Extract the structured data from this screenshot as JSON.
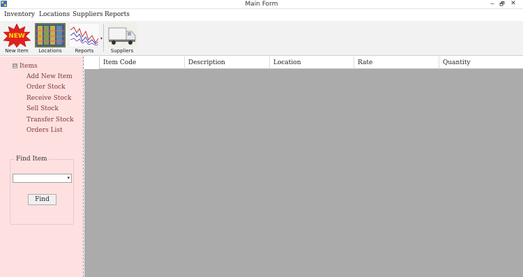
{
  "window": {
    "title": "Main Form",
    "controls": {
      "minimize": "─",
      "restore": "🗗",
      "close": "✕"
    }
  },
  "menu": [
    "Inventory",
    "Locations",
    "Suppliers",
    "Reports"
  ],
  "toolbar": {
    "new_item": {
      "label": "New Item",
      "badge": "NEW"
    },
    "locations": {
      "label": "Locations"
    },
    "reports": {
      "label": "Reports",
      "dropdown": "▾"
    },
    "suppliers": {
      "label": "Suppliers"
    }
  },
  "tree": {
    "toggle": "⊟",
    "root": "Items",
    "children": [
      "Add New Item",
      "Order Stock",
      "Receive Stock",
      "Sell Stock",
      "Transfer Stock",
      "Orders List"
    ]
  },
  "find": {
    "legend": "Find Item",
    "select_value": "",
    "chevron": "▾",
    "button": "Find"
  },
  "grid": {
    "columns": [
      "Item Code",
      "Description",
      "Location",
      "Rate",
      "Quantity"
    ]
  },
  "colors": {
    "left_panel_bg": "#ffe0e0",
    "grid_bg": "#ababab",
    "tree_text": "#7a3a3a"
  }
}
